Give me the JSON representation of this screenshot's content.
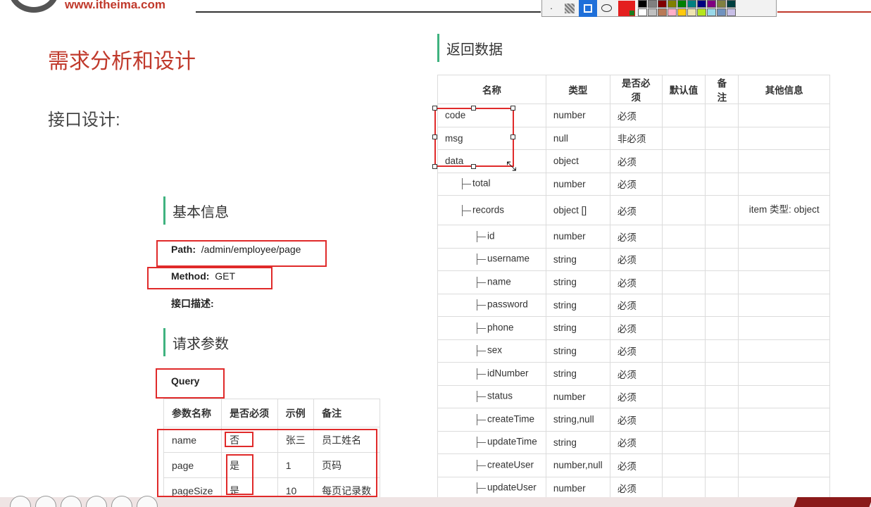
{
  "header": {
    "url": "www.itheima.com"
  },
  "toolbar": {
    "tools": [
      "pointer",
      "hatch-fill",
      "rectangle",
      "ellipse"
    ],
    "current_color": "#e41e1e",
    "palette": [
      "#000000",
      "#808080",
      "#800000",
      "#808000",
      "#008000",
      "#008080",
      "#000080",
      "#800080",
      "#808040",
      "#004040",
      "#ffffff",
      "#c0c0c0",
      "#b97a57",
      "#ffaec9",
      "#ffc90e",
      "#efe4b0",
      "#b5e61d",
      "#99d9ea",
      "#7092be",
      "#c8bfe7"
    ]
  },
  "left": {
    "title": "需求分析和设计",
    "subtitle": "接口设计:",
    "basic_info_heading": "基本信息",
    "path_label": "Path:",
    "path_value": "/admin/employee/page",
    "method_label": "Method:",
    "method_value": "GET",
    "desc_label": "接口描述:",
    "request_heading": "请求参数",
    "query_label": "Query",
    "params": {
      "headers": [
        "参数名称",
        "是否必须",
        "示例",
        "备注"
      ],
      "rows": [
        [
          "name",
          "否",
          "张三",
          "员工姓名"
        ],
        [
          "page",
          "是",
          "1",
          "页码"
        ],
        [
          "pageSize",
          "是",
          "10",
          "每页记录数"
        ]
      ]
    }
  },
  "right": {
    "heading": "返回数据",
    "table": {
      "headers": [
        "名称",
        "类型",
        "是否必须",
        "默认值",
        "备注",
        "其他信息"
      ],
      "rows": [
        {
          "name": "code",
          "level": 0,
          "type": "number",
          "required": "必须",
          "other": ""
        },
        {
          "name": "msg",
          "level": 0,
          "type": "null",
          "required": "非必须",
          "other": ""
        },
        {
          "name": "data",
          "level": 0,
          "type": "object",
          "required": "必须",
          "other": ""
        },
        {
          "name": "total",
          "level": 1,
          "type": "number",
          "required": "必须",
          "other": ""
        },
        {
          "name": "records",
          "level": 1,
          "type": "object []",
          "required": "必须",
          "other": "item 类型: object"
        },
        {
          "name": "id",
          "level": 2,
          "type": "number",
          "required": "必须",
          "other": ""
        },
        {
          "name": "username",
          "level": 2,
          "type": "string",
          "required": "必须",
          "other": ""
        },
        {
          "name": "name",
          "level": 2,
          "type": "string",
          "required": "必须",
          "other": ""
        },
        {
          "name": "password",
          "level": 2,
          "type": "string",
          "required": "必须",
          "other": ""
        },
        {
          "name": "phone",
          "level": 2,
          "type": "string",
          "required": "必须",
          "other": ""
        },
        {
          "name": "sex",
          "level": 2,
          "type": "string",
          "required": "必须",
          "other": ""
        },
        {
          "name": "idNumber",
          "level": 2,
          "type": "string",
          "required": "必须",
          "other": ""
        },
        {
          "name": "status",
          "level": 2,
          "type": "number",
          "required": "必须",
          "other": ""
        },
        {
          "name": "createTime",
          "level": 2,
          "type": "string,null",
          "required": "必须",
          "other": ""
        },
        {
          "name": "updateTime",
          "level": 2,
          "type": "string",
          "required": "必须",
          "other": ""
        },
        {
          "name": "createUser",
          "level": 2,
          "type": "number,null",
          "required": "必须",
          "other": ""
        },
        {
          "name": "updateUser",
          "level": 2,
          "type": "number",
          "required": "必须",
          "other": ""
        }
      ]
    }
  },
  "colors": {
    "accent_red": "#c0392b",
    "annotation_red": "#e02a2a",
    "section_bar": "#3fb27f"
  }
}
